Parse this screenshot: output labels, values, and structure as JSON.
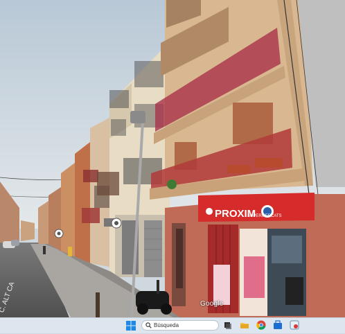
{
  "scene": {
    "type": "street-view",
    "description_labels": {
      "store_name": "PROXIM",
      "store_suffix": "SUPERMERCATS",
      "watermark": "Google",
      "road_marking": "C. ALT CA"
    }
  },
  "taskbar": {
    "search_placeholder": "Búsqueda",
    "icons": [
      "windows-start-icon",
      "search-icon",
      "task-view-icon",
      "file-explorer-icon",
      "chrome-icon",
      "store-icon",
      "app-icon"
    ]
  },
  "colors": {
    "sky": "#cfd8df",
    "facade_main": "#d9b790",
    "balcony_red": "#b03a3a",
    "store_red": "#d62b2b",
    "taskbar": "#dde6ef"
  }
}
